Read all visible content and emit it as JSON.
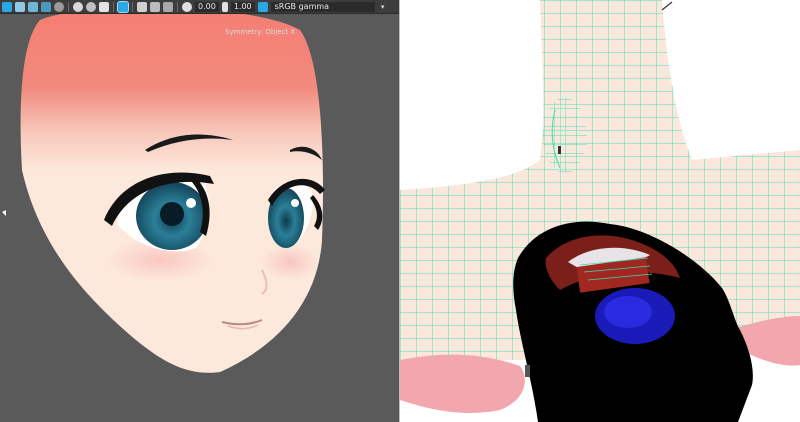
{
  "toolbar": {
    "exposure_value": "0.00",
    "gamma_value": "1.00",
    "color_space": "sRGB gamma",
    "accent_color": "#2aa8e6"
  },
  "left_viewport": {
    "overlay_text": "Symmetry: Object X",
    "background_color": "#5a5a5a"
  },
  "right_viewport": {
    "wireframe_color": "#33e0b0"
  }
}
